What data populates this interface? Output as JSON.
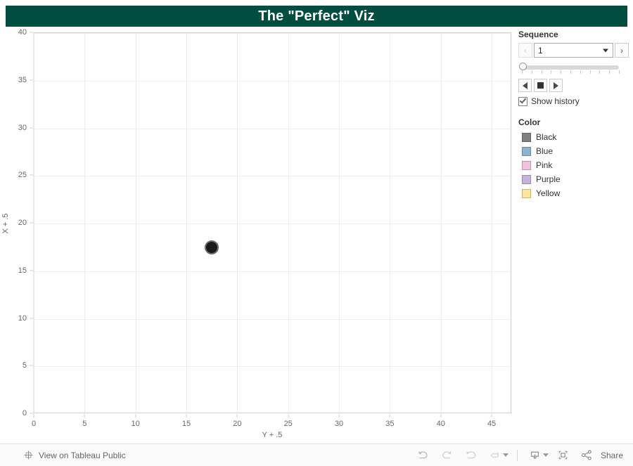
{
  "title": {
    "text": "The \"Perfect\" Viz"
  },
  "chart_data": {
    "type": "scatter",
    "title": "The \"Perfect\" Viz",
    "xlabel": "Y + .5",
    "ylabel": "X + .5",
    "xlim": [
      0,
      47
    ],
    "ylim": [
      0,
      40
    ],
    "xticks": [
      0,
      5,
      10,
      15,
      20,
      25,
      30,
      35,
      40,
      45
    ],
    "yticks": [
      0,
      5,
      10,
      15,
      20,
      25,
      30,
      35,
      40
    ],
    "grid": true,
    "legend_position": "right",
    "series": [
      {
        "name": "Black",
        "color": "#1a1a1a",
        "points": [
          {
            "x": 17.5,
            "y": 17.5
          }
        ]
      }
    ]
  },
  "sequence": {
    "heading": "Sequence",
    "prev_label": "‹",
    "next_label": "›",
    "value": "1",
    "slider_position_percent": 0,
    "slider_tick_count": 11,
    "step_back_name": "step-back",
    "stop_name": "stop",
    "play_name": "play",
    "show_history_label": "Show history",
    "show_history_checked": true
  },
  "color_legend": {
    "heading": "Color",
    "items": [
      {
        "label": "Black",
        "swatch": "#808080"
      },
      {
        "label": "Blue",
        "swatch": "#8cb4d2"
      },
      {
        "label": "Pink",
        "swatch": "#f2bfdd"
      },
      {
        "label": "Purple",
        "swatch": "#c6b3dd"
      },
      {
        "label": "Yellow",
        "swatch": "#ffe49a"
      }
    ]
  },
  "bottom_bar": {
    "tableau_link_label": "View on Tableau Public",
    "share_label": "Share",
    "icons": {
      "undo": "undo-icon",
      "redo": "redo-icon",
      "revert": "revert-icon",
      "refresh": "refresh-icon",
      "download": "download-icon",
      "fullscreen": "fullscreen-icon",
      "share": "share-icon"
    }
  }
}
